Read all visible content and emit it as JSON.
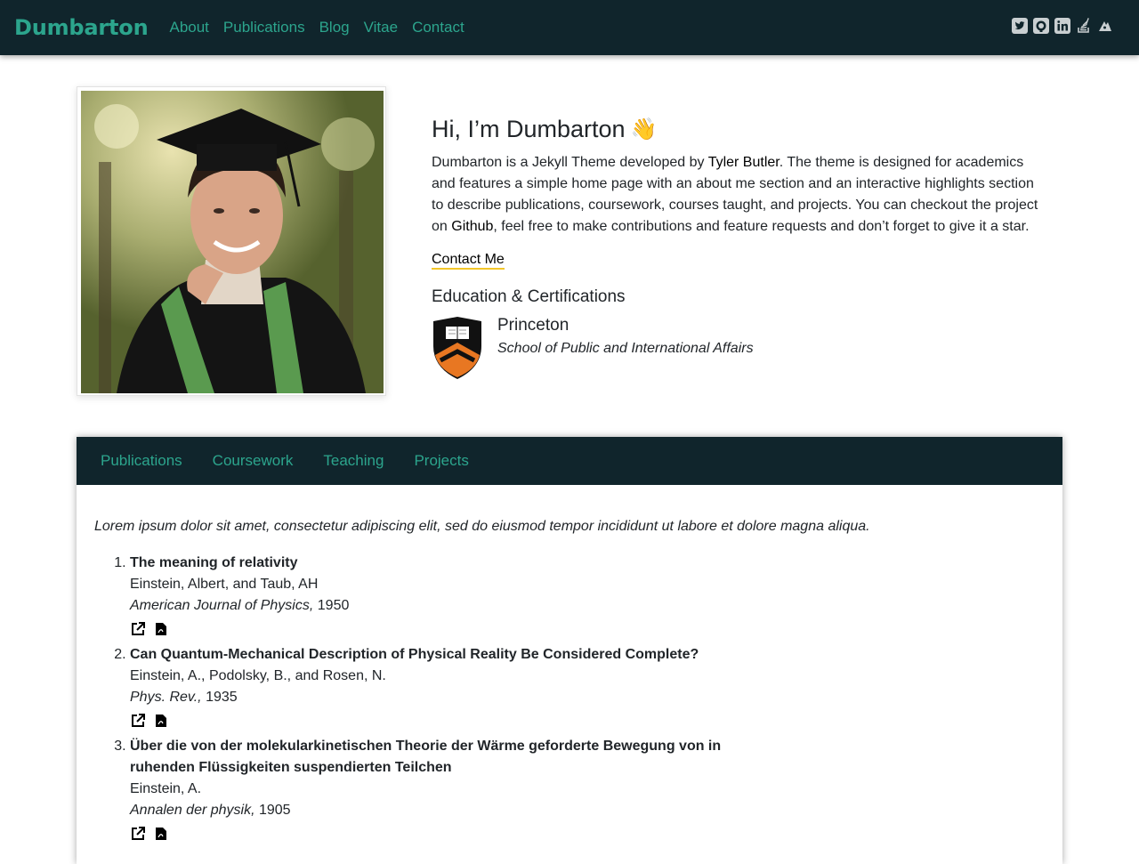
{
  "nav": {
    "brand": "Dumbarton",
    "links": [
      "About",
      "Publications",
      "Blog",
      "Vitae",
      "Contact"
    ],
    "social_icons": [
      "twitter-icon",
      "github-icon",
      "linkedin-icon",
      "stackoverflow-icon",
      "inspire-icon"
    ]
  },
  "about": {
    "greeting": "Hi, I’m Dumbarton",
    "wave": "👋",
    "bio_prefix": "Dumbarton is a Jekyll Theme developed by ",
    "bio_author": "Tyler Butler",
    "bio_middle": ". The theme is designed for academics and features a simple home page with an about me section and an interactive highlights section to describe publications, coursework, courses taught, and projects. You can checkout the project on ",
    "bio_github": "Github",
    "bio_suffix": ", feel free to make contributions and feature requests and don’t forget to give it a star.",
    "contact_label": "Contact Me",
    "education_heading": "Education & Certifications",
    "education": {
      "name": "Princeton",
      "school": "School of Public and International Affairs"
    }
  },
  "highlights": {
    "tabs": [
      "Publications",
      "Coursework",
      "Teaching",
      "Projects"
    ],
    "intro": "Lorem ipsum dolor sit amet, consectetur adipiscing elit, sed do eiusmod tempor incididunt ut labore et dolore magna aliqua.",
    "publications": [
      {
        "title": "The meaning of relativity",
        "authors": "Einstein, Albert, and Taub, AH",
        "journal": "American Journal of Physics,",
        "year": "1950"
      },
      {
        "title": "Can Quantum-Mechanical Description of Physical Reality Be Considered Complete?",
        "authors": "Einstein, A., Podolsky, B., and Rosen, N.",
        "journal": "Phys. Rev.,",
        "year": "1935"
      },
      {
        "title": "Über die von der molekularkinetischen Theorie der Wärme geforderte Bewegung von in ruhenden Flüssigkeiten suspendierten Teilchen",
        "authors": "Einstein, A.",
        "journal": "Annalen der physik,",
        "year": "1905"
      }
    ]
  },
  "colors": {
    "nav_bg": "#10252c",
    "accent": "#2ca58d",
    "underline": "#f3c629",
    "princeton_orange": "#e87722"
  }
}
